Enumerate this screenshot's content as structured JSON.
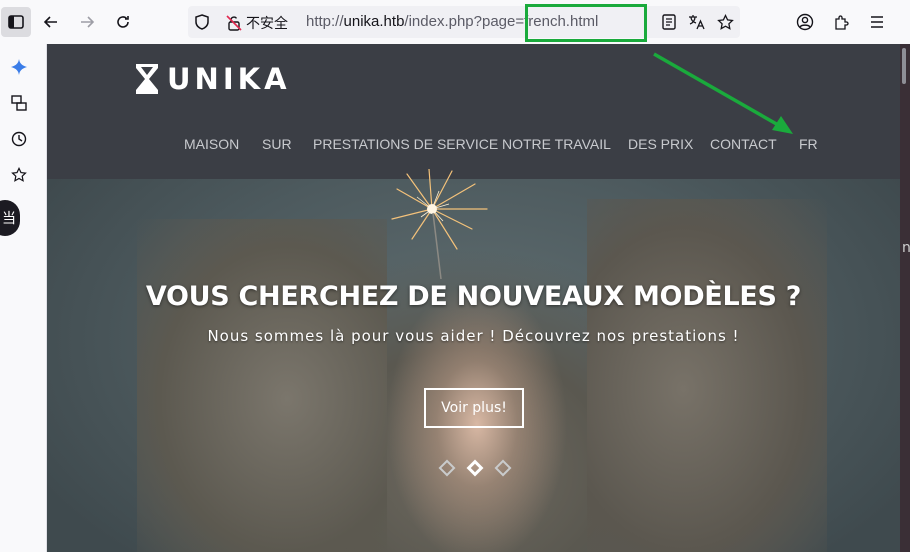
{
  "browser": {
    "url_prefix": "http://",
    "url_host": "unika.htb",
    "url_path": "/index.php?page",
    "url_highlight": "=french.html",
    "security_label": "不安全",
    "annotation_color": "#1aaa3c"
  },
  "sidebar": {
    "icons": [
      "sparkle-icon",
      "sync-tabs-icon",
      "history-icon",
      "bookmark-star-icon"
    ],
    "round_label": "当"
  },
  "site": {
    "logo_text": "UNIKA",
    "header_bg": "#3b3e45",
    "nav": [
      {
        "label": "MAISON"
      },
      {
        "label": "SUR"
      },
      {
        "label": "PRESTATIONS DE SERVICE"
      },
      {
        "label": "NOTRE TRAVAIL"
      },
      {
        "label": "DES PRIX"
      },
      {
        "label": "CONTACT"
      },
      {
        "label": "FR"
      }
    ]
  },
  "hero": {
    "title": "VOUS CHERCHEZ DE NOUVEAUX MODÈLES ?",
    "subtitle": "Nous sommes là pour vous aider ! Découvrez nos prestations !",
    "button": "Voir plus!",
    "slides": 3,
    "active_slide": 2
  },
  "page_edge_letter": "n"
}
